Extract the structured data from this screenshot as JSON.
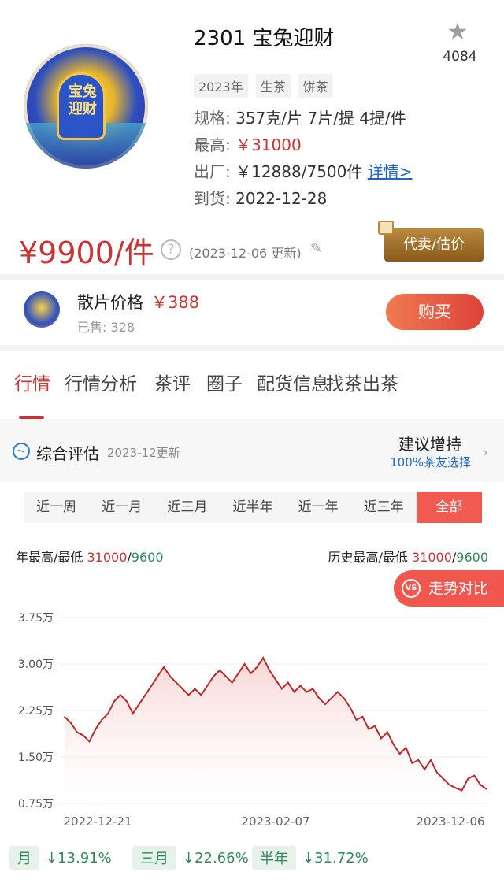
{
  "product": {
    "title": "2301 宝兔迎财",
    "cover_text": "宝兔迎财",
    "favorite_count": "4084",
    "tags": [
      "2023年",
      "生茶",
      "饼茶"
    ],
    "spec_label": "规格:",
    "spec_value": "357克/片 7片/提 4提/件",
    "high_label": "最高:",
    "high_value": "￥31000",
    "factory_label": "出厂:",
    "factory_value": "￥12888/7500件",
    "factory_link": "详情>",
    "arrival_label": "到货:",
    "arrival_value": "2022-12-28"
  },
  "price": {
    "main": "¥9900/件",
    "update_note": "(2023-12-06 更新)",
    "consign_label": "代卖/估价"
  },
  "loose": {
    "title": "散片价格",
    "price": "￥388",
    "sold": "已售: 328",
    "buy_label": "购买"
  },
  "tabs": [
    "行情",
    "行情分析",
    "茶评",
    "圈子",
    "配货信息",
    "找茶出茶"
  ],
  "assessment": {
    "title": "综合评估",
    "date": "2023-12更新",
    "recommendation": "建议增持",
    "subtitle": "100%茶友选择"
  },
  "periods": [
    "近一周",
    "近一月",
    "近三月",
    "近半年",
    "近一年",
    "近三年",
    "全部"
  ],
  "stats": {
    "year_label": "年最高/最低",
    "year_high": "31000",
    "year_sep": "/",
    "year_low": "9600",
    "hist_label": "历史最高/最低",
    "hist_high": "31000",
    "hist_sep": "/",
    "hist_low": "9600"
  },
  "compare_label": "走势对比",
  "changes": [
    {
      "label": "月",
      "value": "↓13.91%"
    },
    {
      "label": "三月",
      "value": "↓22.66%"
    },
    {
      "label": "半年",
      "value": "↓31.72%"
    }
  ],
  "colors": {
    "accent_red": "#c93333",
    "down_green": "#2f8a5a",
    "link_blue": "#1e66c8"
  },
  "chart_data": {
    "type": "line",
    "y_tick_labels": [
      "3.75万",
      "3.00万",
      "2.25万",
      "1.50万",
      "0.75万"
    ],
    "y_ticks": [
      37500,
      30000,
      22500,
      15000,
      7500
    ],
    "ylim": [
      7500,
      37500
    ],
    "x_tick_labels": [
      "2022-12-21",
      "2023-02-07",
      "2023-12-06"
    ],
    "series": [
      {
        "values": [
          21500,
          20500,
          19000,
          18500,
          17500,
          19500,
          21000,
          22000,
          24000,
          25000,
          24000,
          22000,
          23500,
          25000,
          26500,
          28000,
          29500,
          28000,
          27000,
          26000,
          25000,
          26000,
          25000,
          26500,
          28000,
          29000,
          28000,
          27000,
          28500,
          30000,
          28500,
          29500,
          31000,
          29000,
          27500,
          26000,
          27000,
          25500,
          26500,
          25500,
          26000,
          24500,
          23500,
          24500,
          25500,
          24500,
          23000,
          21000,
          21500,
          19500,
          20000,
          18000,
          19000,
          17000,
          15500,
          16500,
          14000,
          14500,
          13000,
          14500,
          12500,
          11500,
          10500,
          10000,
          9600,
          11500,
          12000,
          10500,
          9800
        ]
      }
    ],
    "grid": false
  }
}
